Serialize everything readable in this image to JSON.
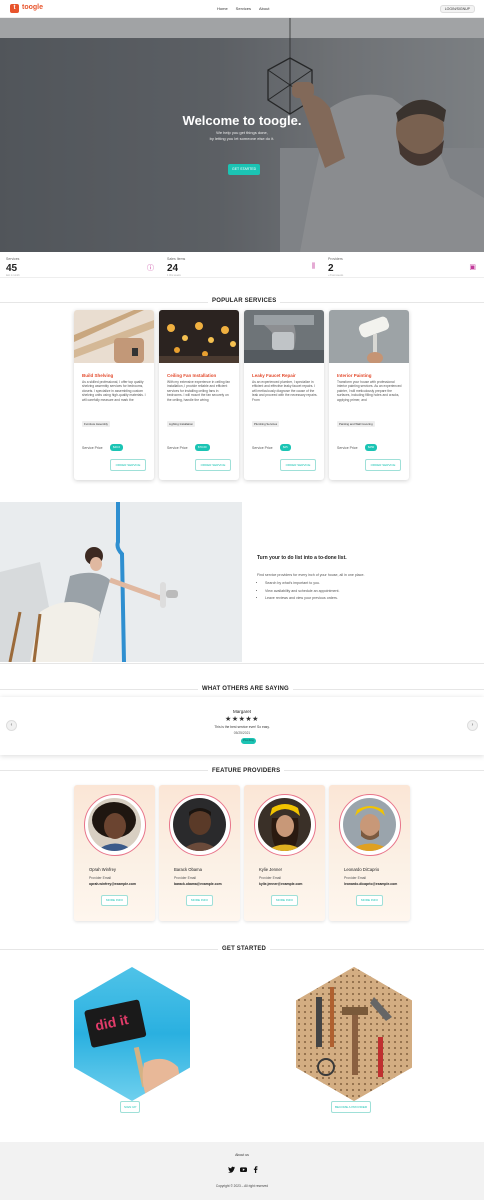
{
  "brand": {
    "name": "toogle",
    "logo_letter": "t"
  },
  "nav": {
    "links": [
      "Home",
      "Services",
      "About"
    ],
    "login_label": "LOGIN/SIGNUP"
  },
  "hero": {
    "title": "Welcome to toogle.",
    "subtitle_line1": "We help you get things done,",
    "subtitle_line2": "by letting you let someone else do it.",
    "cta": "GET STARTED"
  },
  "stats": [
    {
      "label": "Services",
      "value": "45",
      "note": "last 1 month",
      "icon": "info-icon"
    },
    {
      "label": "Sales Items",
      "value": "24",
      "note": "1 this weeks",
      "icon": "bars-icon"
    },
    {
      "label": "Providers",
      "value": "2",
      "note": "+3 last weeks",
      "icon": "shop-icon"
    }
  ],
  "popular": {
    "title": "POPULAR SERVICES",
    "price_label": "Service Price",
    "order_label": "ORDER SERVICE",
    "items": [
      {
        "title": "Build Shelving",
        "desc": "As a skilled professional, I offer top quality shelving assembly services for bedrooms, closets. I specialize in assembling custom shelving units using high-quality materials. I will carefully measure and mark the",
        "tag": "Furniture Assembly",
        "price": "$40.0"
      },
      {
        "title": "Ceiling Fan Installation",
        "desc": "With my extensive experience in ceiling fan installation, I provide reliable and efficient services for installing ceiling fans in bedrooms. I will mount the fan securely on the ceiling, handle the wiring",
        "tag": "Lighting Installation",
        "price": "$70.00"
      },
      {
        "title": "Leaky Faucet Repair",
        "desc": "As an experienced plumber, I specialize in efficient and effective leaky faucet repairs. I will meticulously diagnose the cause of the leak and proceed with the necessary repairs. From",
        "tag": "Plumbing Services",
        "price": "$25"
      },
      {
        "title": "Interior Painting",
        "desc": "Transform your house with professional interior painting services. As an experienced painter, I will meticulously prepare the surfaces, including filling holes and cracks, applying primer, and",
        "tag": "Painting and Wall Covering",
        "price": "$250"
      }
    ]
  },
  "todo": {
    "title": "Turn your to do list into a to-done list.",
    "intro": "Find service providers for every inch of your house, all in one place.",
    "bullets": [
      "Search by what's important to you.",
      "View availability and schedule an appointment.",
      "Leave reviews and view your previous orders."
    ]
  },
  "testimonials": {
    "title": "WHAT OTHERS ARE SAYING",
    "name": "Margaret",
    "stars": "★★★★★",
    "quote": "This is the best service ever! So easy.",
    "date": "05/25/2021",
    "badge": "Plumbing"
  },
  "providers": {
    "title": "FEATURE PROVIDERS",
    "email_label": "Provider Email",
    "more_label": "MORE INFO",
    "items": [
      {
        "name": "Oprah Winfrey",
        "email": "oprah.winfrey@example.com"
      },
      {
        "name": "Barack Obama",
        "email": "barack.obama@example.com"
      },
      {
        "name": "Kylie Jenner",
        "email": "kylie.jenner@example.com"
      },
      {
        "name": "Leonardo DiCaprio",
        "email": "leonardo.dicaprio@example.com"
      }
    ]
  },
  "get_started": {
    "title": "GET STARTED",
    "signup": "SIGN UP",
    "provider": "BECOME A PROVIDER",
    "sign_text": "did it"
  },
  "footer": {
    "about": "About us",
    "copyright": "Copyright © 2023 – All right reserved"
  },
  "colors": {
    "accent": "#1bc4b4",
    "brand": "#e8542c",
    "service_title": "#e34a2c"
  }
}
